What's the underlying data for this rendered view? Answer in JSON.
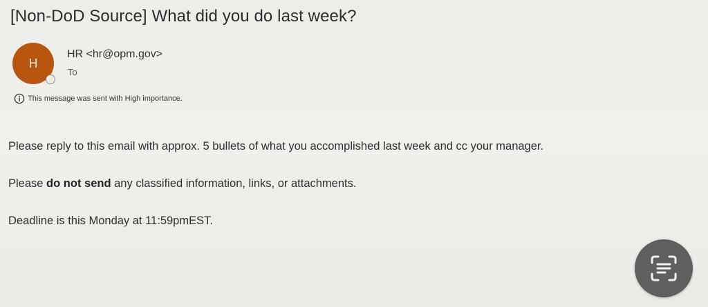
{
  "email": {
    "subject": "[Non-DoD Source] What did you do last week?",
    "sender": {
      "initial": "H",
      "display": "HR <hr@opm.gov>"
    },
    "to_label": "To",
    "importance_notice": "This message was sent with High importance.",
    "body": {
      "line1": "Please reply to this email with approx. 5 bullets of what you accomplished last week and cc your manager.",
      "line2_before": "Please ",
      "line2_bold": "do not send",
      "line2_after": " any classified information, links, or attachments.",
      "line3": "Deadline is this Monday at 11:59pmEST."
    }
  },
  "icons": {
    "info": "info-icon",
    "scan_text": "scan-text-icon",
    "presence": "presence-status-icon"
  },
  "colors": {
    "avatar_bg": "#b8550f",
    "scan_button_bg": "#5f5f5f"
  }
}
